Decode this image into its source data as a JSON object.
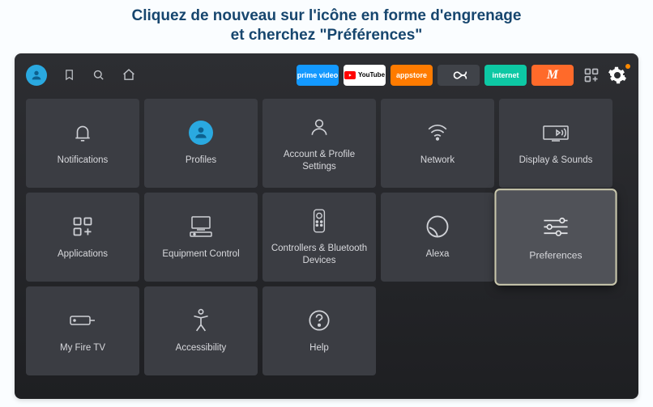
{
  "caption": {
    "line1": "Cliquez de nouveau sur l'icône en forme d'engrenage",
    "line2": "et cherchez \"Préférences\""
  },
  "topbar": {
    "apps": {
      "prime": "prime video",
      "youtube": "YouTube",
      "appstore": "appstore",
      "internet": "internet",
      "m": "M"
    }
  },
  "tiles": {
    "notifications": "Notifications",
    "profiles": "Profiles",
    "account": "Account & Profile Settings",
    "network": "Network",
    "display": "Display & Sounds",
    "applications": "Applications",
    "equipment": "Equipment Control",
    "controllers": "Controllers & Bluetooth Devices",
    "alexa": "Alexa",
    "preferences": "Preferences",
    "myfire": "My Fire TV",
    "accessibility": "Accessibility",
    "help": "Help"
  }
}
